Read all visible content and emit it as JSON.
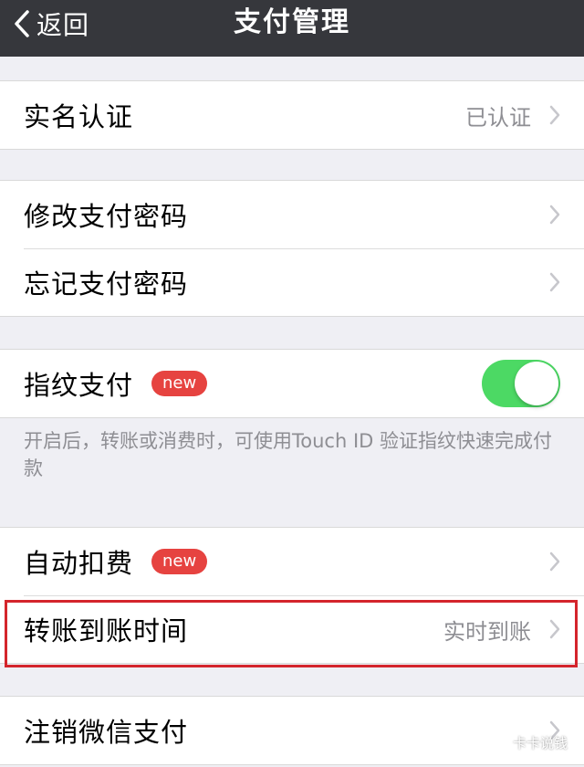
{
  "navbar": {
    "back_label": "返回",
    "title": "支付管理"
  },
  "sections": {
    "identity": {
      "label": "实名认证",
      "value": "已认证"
    },
    "change_password": {
      "label": "修改支付密码"
    },
    "forgot_password": {
      "label": "忘记支付密码"
    },
    "fingerprint": {
      "label": "指纹支付",
      "badge": "new",
      "enabled": true
    },
    "fingerprint_desc": "开启后，转账或消费时，可使用Touch ID 验证指纹快速完成付款",
    "auto_deduct": {
      "label": "自动扣费",
      "badge": "new"
    },
    "transfer_time": {
      "label": "转账到账时间",
      "value": "实时到账"
    },
    "cancel_pay": {
      "label": "注销微信支付"
    }
  },
  "watermark": {
    "text": "卡卡说钱"
  },
  "colors": {
    "navbar": "#36373c",
    "background": "#efeff4",
    "toggle_on": "#4cd964",
    "badge": "#e64340",
    "highlight": "#d4252c"
  }
}
